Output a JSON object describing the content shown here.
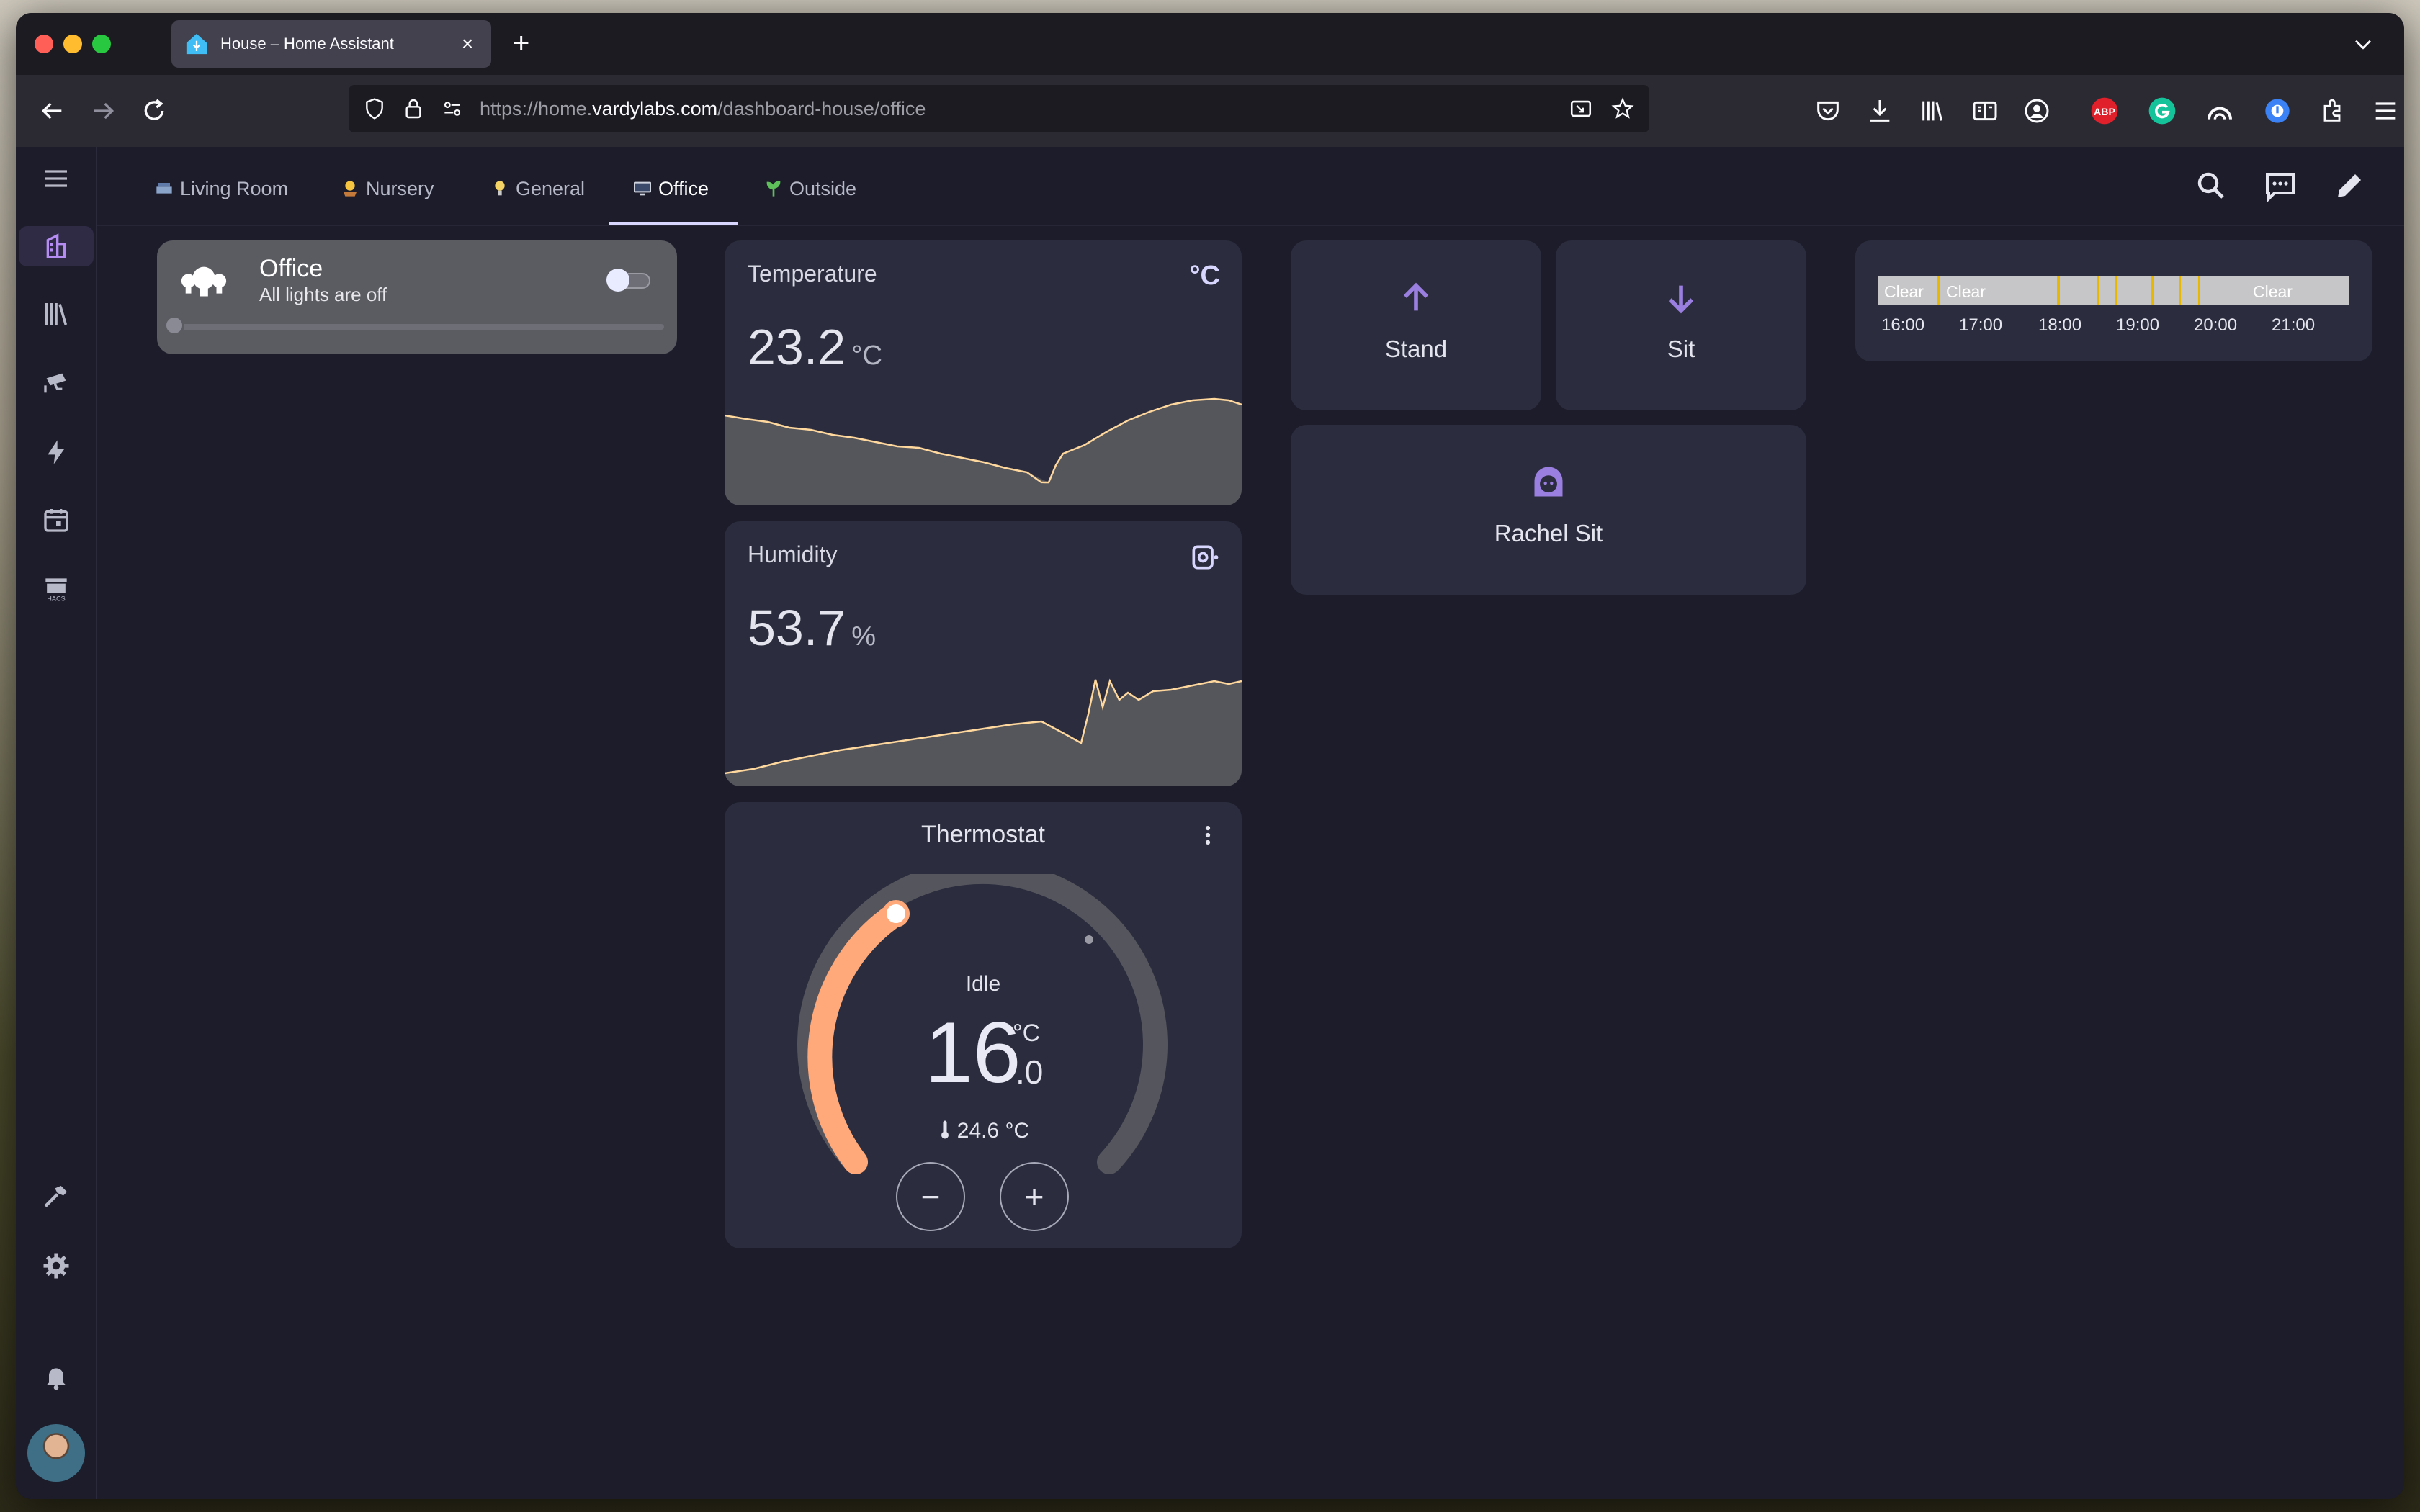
{
  "browser": {
    "tab_title": "House – Home Assistant",
    "url_host_prefix": "https://home.",
    "url_host": "vardylabs.com",
    "url_path": "/dashboard-house/office"
  },
  "dashboard": {
    "views": [
      {
        "label": "Living Room",
        "icon": "couch-icon"
      },
      {
        "label": "Nursery",
        "icon": "baby-icon"
      },
      {
        "label": "General",
        "icon": "bulb-icon"
      },
      {
        "label": "Office",
        "icon": "desktop-icon"
      },
      {
        "label": "Outside",
        "icon": "plant-icon"
      }
    ],
    "active_view": "Office"
  },
  "sidebar": {
    "items": [
      "home-icon",
      "library-icon",
      "cctv-icon",
      "energy-icon",
      "calendar-icon",
      "hacs-icon",
      "developer-tools-icon",
      "settings-icon",
      "notifications-icon"
    ]
  },
  "light": {
    "name": "Office",
    "state": "All lights are off",
    "on": false,
    "brightness": 0
  },
  "temperature": {
    "title": "Temperature",
    "value": "23.2",
    "unit": "°C",
    "unit_icon": "°C"
  },
  "humidity": {
    "title": "Humidity",
    "value": "53.7",
    "unit": "%"
  },
  "thermostat": {
    "title": "Thermostat",
    "status": "Idle",
    "target_int": "16",
    "target_dec": ".0",
    "unit": "°C",
    "current": "24.6 °C",
    "minus": "−",
    "plus": "+",
    "arc_color": "#ffa97a"
  },
  "desk": {
    "stand": "Stand",
    "sit": "Sit",
    "person": "Rachel Sit",
    "accent": "#9a7ee0"
  },
  "weather": {
    "conditions": [
      "Clear",
      "Clear",
      "Clear"
    ],
    "times": [
      "16:00",
      "17:00",
      "18:00",
      "19:00",
      "20:00",
      "21:00"
    ],
    "tick_color": "#e6b800"
  }
}
